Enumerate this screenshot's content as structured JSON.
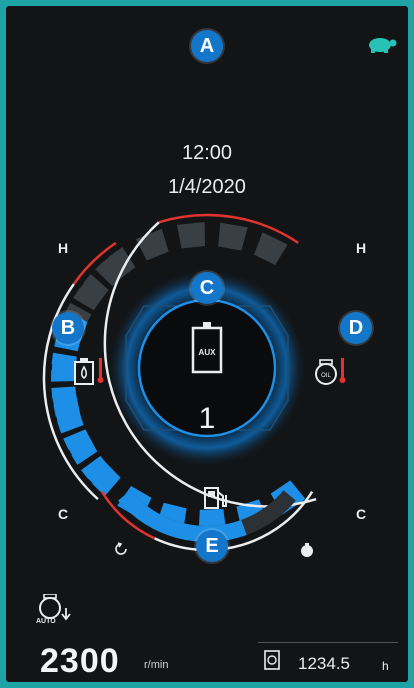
{
  "markers": {
    "a": "A",
    "b": "B",
    "c": "C",
    "d": "D",
    "e": "E"
  },
  "clock": {
    "time": "12:00",
    "date": "1/4/2020"
  },
  "coolant_gauge": {
    "high_label": "H",
    "low_label": "C",
    "level": 0.65
  },
  "engine_oil_gauge": {
    "high_label": "H",
    "low_label": "C",
    "level": 0.62
  },
  "aux": {
    "label": "AUX",
    "count": "1"
  },
  "fuel_gauge": {
    "level": 0.7
  },
  "engine": {
    "rpm": "2300",
    "rpm_unit": "r/min",
    "icon_caption": "AUTO"
  },
  "hour_meter": {
    "value": "1234.5",
    "unit": "h"
  },
  "icons": {
    "eco": "turtle-icon",
    "coolant": "coolant-temperature-icon",
    "oil": "engine-oil-temperature-icon",
    "aux": "aux-battery-icon",
    "fuel": "fuel-pump-icon",
    "fuel_low": "fuel-empty-icon",
    "fuel_full": "fuel-full-icon",
    "auto_idle": "auto-idle-icon",
    "hours": "hour-meter-icon"
  },
  "colors": {
    "accent": "#1e8fe6",
    "warning": "#e2332f",
    "background": "#121416",
    "frame": "#1fa3a6"
  }
}
